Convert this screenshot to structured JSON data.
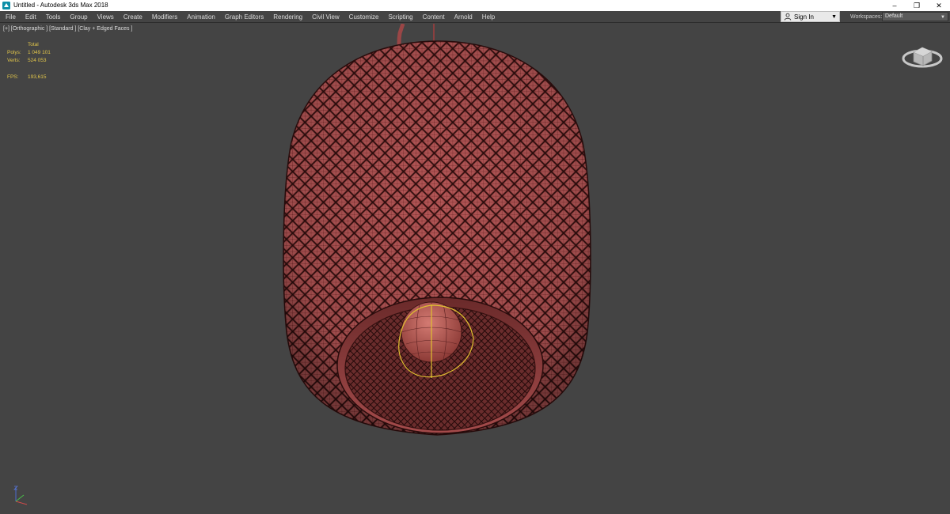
{
  "window": {
    "title": "Untitled - Autodesk 3ds Max 2018",
    "controls": {
      "minimize": "–",
      "restore": "❐",
      "close": "✕"
    }
  },
  "menu": [
    "File",
    "Edit",
    "Tools",
    "Group",
    "Views",
    "Create",
    "Modifiers",
    "Animation",
    "Graph Editors",
    "Rendering",
    "Civil View",
    "Customize",
    "Scripting",
    "Content",
    "Arnold",
    "Help"
  ],
  "account": {
    "sign_in_label": "Sign In"
  },
  "workspaces": {
    "label": "Workspaces:",
    "value": "Default"
  },
  "viewport": {
    "label": "[+] [Orthographic ] [Standard ] [Clay + Edged Faces ]",
    "stats": {
      "header": "Total",
      "polys_label": "Polys:",
      "polys_value": "1 049 101",
      "verts_label": "Verts:",
      "verts_value": "524 053",
      "fps_label": "FPS:",
      "fps_value": "193,615"
    }
  },
  "colors": {
    "viewport_bg": "#444444",
    "mesh_fill": "#a24848",
    "mesh_wire": "#3a1212",
    "stats_text": "#e2c64a",
    "selection_gizmo": "#e0c030"
  },
  "icons": {
    "app": "3ds-max-logo-icon",
    "user": "user-icon",
    "viewcube": "viewcube-icon",
    "axis": "axis-tripod-icon"
  }
}
